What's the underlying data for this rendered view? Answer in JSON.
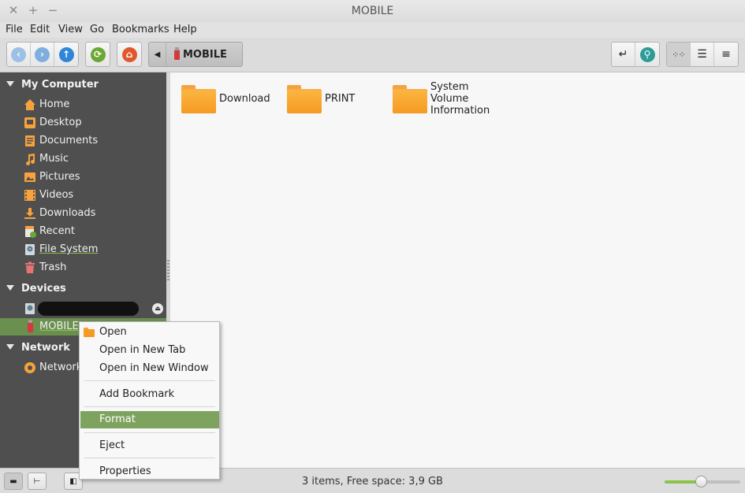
{
  "window": {
    "title": "MOBILE",
    "close_glyph": "✕",
    "max_glyph": "+",
    "min_glyph": "−"
  },
  "menu": [
    "File",
    "Edit",
    "View",
    "Go",
    "Bookmarks",
    "Help"
  ],
  "toolbar": {
    "path_label": "MOBILE",
    "icons": [
      "back-icon",
      "forward-icon",
      "up-icon",
      "reload-icon",
      "home-icon",
      "toggle-location-icon",
      "search-icon",
      "icon-view-icon",
      "list-view-icon",
      "compact-view-icon"
    ]
  },
  "sidebar": {
    "sections": {
      "my_computer": "My Computer",
      "devices": "Devices",
      "network": "Network"
    },
    "places": [
      "Home",
      "Desktop",
      "Documents",
      "Music",
      "Pictures",
      "Videos",
      "Downloads",
      "Recent",
      "File System",
      "Trash"
    ],
    "devices": [
      "MOBILE"
    ],
    "network_items": [
      "Network"
    ]
  },
  "files": [
    "Download",
    "PRINT",
    "System Volume Information"
  ],
  "context_menu": [
    "Open",
    "Open in New Tab",
    "Open in New Window",
    "Add Bookmark",
    "Format",
    "Eject",
    "Properties"
  ],
  "status": {
    "text": "3 items, Free space: 3,9 GB",
    "zoom_fraction": 0.48
  },
  "colors": {
    "accent": "#8bc34a",
    "sidebar_bg": "#4f4f4f",
    "selection": "#6a8f4f",
    "folder": "#f59a22"
  }
}
